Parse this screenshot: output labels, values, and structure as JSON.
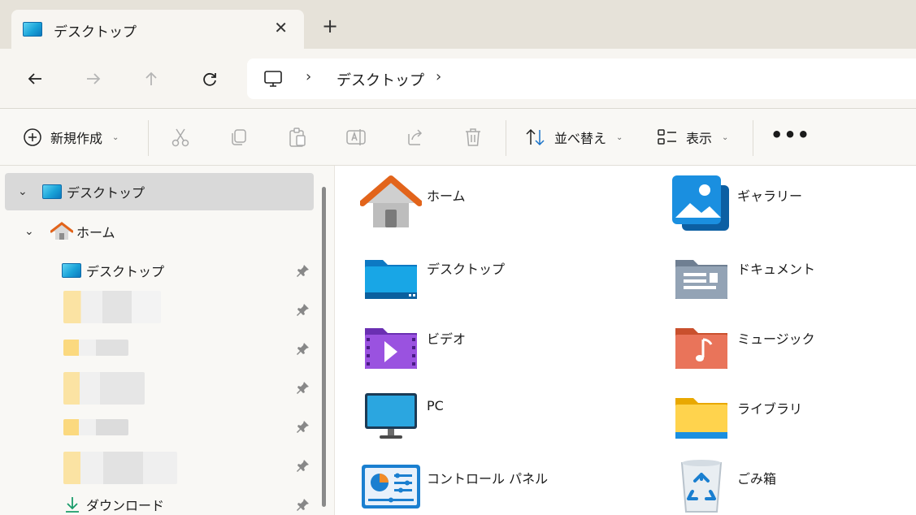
{
  "window": {
    "tab_title": "デスクトップ",
    "close_glyph": "✕",
    "new_tab_glyph": "+"
  },
  "nav": {
    "icons": [
      "back-arrow-icon",
      "forward-arrow-icon",
      "up-arrow-icon",
      "refresh-icon"
    ],
    "address": {
      "root_icon": "pc-monitor-icon",
      "separator": "›",
      "crumb": "デスクトップ"
    }
  },
  "commands": {
    "new_label": "新規作成",
    "sort_label": "並べ替え",
    "view_label": "表示",
    "more_glyph": "•••",
    "caret": "⌄",
    "icons": [
      "cut-icon",
      "copy-icon",
      "paste-icon",
      "rename-icon",
      "share-icon",
      "delete-icon"
    ]
  },
  "sidebar": {
    "items": [
      {
        "label": "デスクトップ",
        "icon": "desktop-icon",
        "expanded": true,
        "selected": true
      },
      {
        "label": "ホーム",
        "icon": "home-icon",
        "expanded": true
      },
      {
        "label": "デスクトップ",
        "icon": "desktop-icon",
        "pinned": true
      },
      {
        "label": "ダウンロード",
        "icon": "download-icon",
        "pinned": true
      }
    ],
    "expand_glyph": "⌄"
  },
  "content": {
    "items": [
      {
        "label": "ホーム",
        "icon": "home-icon"
      },
      {
        "label": "ギャラリー",
        "icon": "gallery-icon"
      },
      {
        "label": "デスクトップ",
        "icon": "desktop-folder-icon"
      },
      {
        "label": "ドキュメント",
        "icon": "documents-folder-icon"
      },
      {
        "label": "ビデオ",
        "icon": "videos-folder-icon"
      },
      {
        "label": "ミュージック",
        "icon": "music-folder-icon"
      },
      {
        "label": "PC",
        "icon": "pc-monitor-icon"
      },
      {
        "label": "ライブラリ",
        "icon": "libraries-folder-icon"
      },
      {
        "label": "コントロール パネル",
        "icon": "control-panel-icon"
      },
      {
        "label": "ごみ箱",
        "icon": "recycle-bin-icon"
      }
    ]
  },
  "colors": {
    "titlebar": "#e6e2d9",
    "navbar": "#f7f5f1",
    "selected_row": "#d9d9d9",
    "accent": "#0b78bd"
  }
}
